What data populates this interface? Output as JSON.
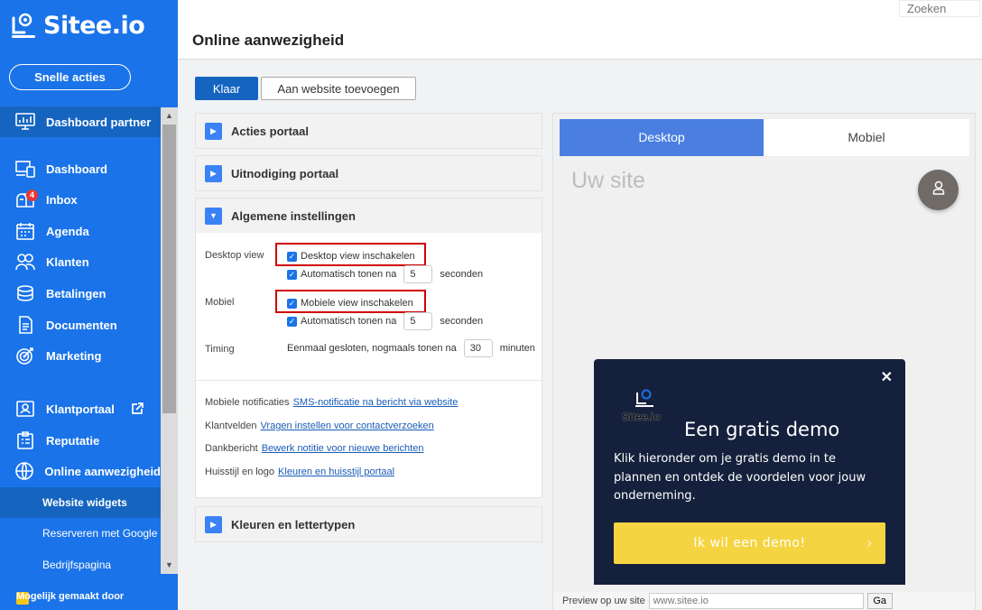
{
  "brand": {
    "name": "Sitee.io",
    "accent": "#1a73e8",
    "accent_dark": "#1565c0"
  },
  "sidebar": {
    "quick_actions": "Snelle acties",
    "items": [
      {
        "label": "Dashboard partner",
        "icon": "monitor-chart-icon"
      },
      {
        "label": "Dashboard",
        "icon": "devices-icon"
      },
      {
        "label": "Inbox",
        "icon": "mailbox-icon",
        "badge": "4"
      },
      {
        "label": "Agenda",
        "icon": "calendar-icon"
      },
      {
        "label": "Klanten",
        "icon": "users-icon"
      },
      {
        "label": "Betalingen",
        "icon": "coins-icon"
      },
      {
        "label": "Documenten",
        "icon": "document-icon"
      },
      {
        "label": "Marketing",
        "icon": "target-icon"
      },
      {
        "label": "Klantportaal",
        "icon": "portal-icon"
      },
      {
        "label": "Reputatie",
        "icon": "clipboard-list-icon"
      },
      {
        "label": "Online aanwezigheid",
        "icon": "globe-icon"
      }
    ],
    "sub_items": [
      "Website widgets",
      "Reserveren met Google",
      "Bedrijfspagina"
    ],
    "made_by": "Mogelijk gemaakt door"
  },
  "header": {
    "search_placeholder": "Zoeken",
    "title": "Online aanwezigheid"
  },
  "toolbar": {
    "done": "Klaar",
    "add_to_site": "Aan website toevoegen"
  },
  "accordion": {
    "actions_portal": "Acties portaal",
    "invite_portal": "Uitnodiging portaal",
    "general": "Algemene instellingen",
    "colors": "Kleuren en lettertypen"
  },
  "settings": {
    "desktop_label": "Desktop view",
    "desktop_enable": "Desktop view inschakelen",
    "auto_show": "Automatisch tonen na",
    "desktop_seconds": "5",
    "seconds_unit": "seconden",
    "mobile_label": "Mobiel",
    "mobile_enable": "Mobiele view inschakelen",
    "mobile_seconds": "5",
    "timing_label": "Timing",
    "timing_text": "Eenmaal gesloten, nogmaals tonen na",
    "timing_value": "30",
    "minutes_unit": "minuten"
  },
  "links": [
    {
      "label": "Mobiele notificaties",
      "link": "SMS-notificatie na bericht via website"
    },
    {
      "label": "Klantvelden",
      "link": "Vragen instellen voor contactverzoeken"
    },
    {
      "label": "Dankbericht",
      "link": "Bewerk notitie voor nieuwe berichten"
    },
    {
      "label": "Huisstijl en logo",
      "link": "Kleuren en huisstijl portaal"
    }
  ],
  "preview": {
    "tab_desktop": "Desktop",
    "tab_mobile": "Mobiel",
    "placeholder": "Uw site",
    "demo_logo": "Sitee.io",
    "demo_title": "Een gratis demo",
    "demo_text": "Klik hieronder om je gratis demo in te plannen en ontdek de voordelen voor jouw onderneming.",
    "demo_button": "Ik wil een demo!",
    "footer_label": "Preview op uw site",
    "footer_input": "www.sitee.io",
    "go": "Ga"
  }
}
